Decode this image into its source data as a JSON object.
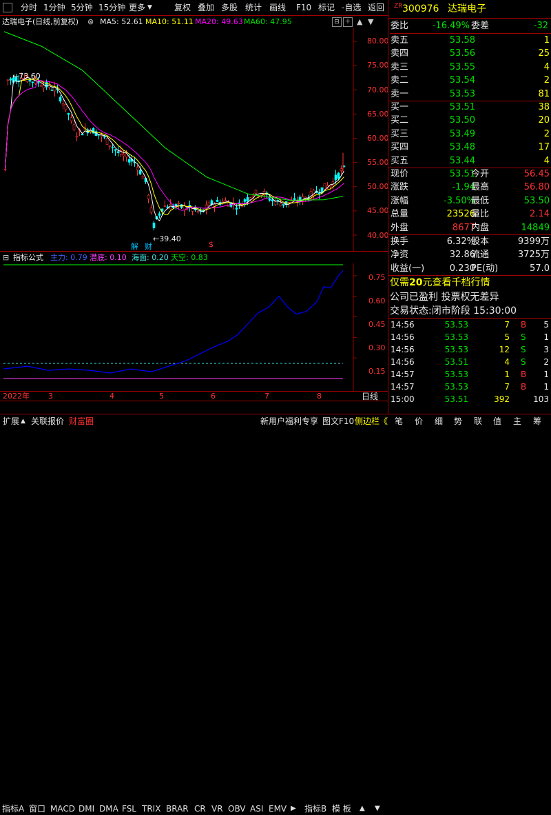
{
  "toolbar": {
    "items": [
      "分时",
      "1分钟",
      "5分钟",
      "15分钟",
      "更多",
      "复权",
      "叠加",
      "多股",
      "统计",
      "画线",
      "F10",
      "标记",
      "-自选",
      "返回"
    ]
  },
  "chart_header": {
    "name": "达瑞电子(日线,前复权)",
    "ma5": "MA5: 52.61",
    "ma10": "MA10: 51.11",
    "ma20": "MA20: 49.63",
    "ma60": "MA60: 47.95"
  },
  "price_axis": [
    "80.00",
    "75.00",
    "70.00",
    "65.00",
    "60.00",
    "55.00",
    "50.00",
    "45.00",
    "40.00"
  ],
  "annotations": {
    "high": "73.60",
    "low": "39.40",
    "jie": "解",
    "cai": "财",
    "s": "$"
  },
  "indicator_header": {
    "title": "指标公式",
    "zl": "主力: 0.79",
    "qd": "潜底: 0.10",
    "hm": "海面: 0.20",
    "tk": "天空: 0.83"
  },
  "indicator_axis": [
    "0.75",
    "0.60",
    "0.45",
    "0.30",
    "0.15"
  ],
  "date_axis": {
    "year": "2022年",
    "months": [
      "3",
      "4",
      "5",
      "6",
      "7",
      "8"
    ],
    "period": "日线"
  },
  "tabs": [
    "指标A",
    "窗口",
    "MACD",
    "DMI",
    "DMA",
    "FSL",
    "TRIX",
    "BRAR",
    "CR",
    "VR",
    "OBV",
    "ASI",
    "EMV",
    "指标B",
    "模 板"
  ],
  "bottom_tabs": [
    "扩展",
    "关联报价",
    "财富圈"
  ],
  "bottom_right": [
    "新用户福利专享",
    "图文F10",
    "侧边栏《"
  ],
  "side_tabs": [
    "笔",
    "价",
    "细",
    "势",
    "联",
    "值",
    "主",
    "筹"
  ],
  "stock": {
    "badge": "ZR",
    "code": "300976",
    "name": "达瑞电子"
  },
  "order_ratio": {
    "wb_label": "委比",
    "wb": "-16.49%",
    "wc_label": "委差",
    "wc": "-32"
  },
  "asks": [
    {
      "label": "卖五",
      "price": "53.58",
      "vol": "1"
    },
    {
      "label": "卖四",
      "price": "53.56",
      "vol": "25"
    },
    {
      "label": "卖三",
      "price": "53.55",
      "vol": "4"
    },
    {
      "label": "卖二",
      "price": "53.54",
      "vol": "2"
    },
    {
      "label": "卖一",
      "price": "53.53",
      "vol": "81"
    }
  ],
  "bids": [
    {
      "label": "买一",
      "price": "53.51",
      "vol": "38"
    },
    {
      "label": "买二",
      "price": "53.50",
      "vol": "20"
    },
    {
      "label": "买三",
      "price": "53.49",
      "vol": "2"
    },
    {
      "label": "买四",
      "price": "53.48",
      "vol": "17"
    },
    {
      "label": "买五",
      "price": "53.44",
      "vol": "4"
    }
  ],
  "stats": [
    {
      "l1": "现价",
      "v1": "53.51",
      "l2": "今开",
      "v2": "56.45"
    },
    {
      "l1": "涨跌",
      "v1": "-1.94",
      "l2": "最高",
      "v2": "56.80"
    },
    {
      "l1": "涨幅",
      "v1": "-3.50%",
      "l2": "最低",
      "v2": "53.50"
    },
    {
      "l1": "总量",
      "v1": "23526",
      "l2": "量比",
      "v2": "2.14"
    },
    {
      "l1": "外盘",
      "v1": "8677",
      "l2": "内盘",
      "v2": "14849"
    }
  ],
  "stats2": [
    {
      "l1": "换手",
      "v1": "6.32%",
      "l2": "股本",
      "v2": "9399万"
    },
    {
      "l1": "净资",
      "v1": "32.86",
      "l2": "流通",
      "v2": "3725万"
    },
    {
      "l1": "收益(一)",
      "v1": "0.230",
      "l2": "PE(动)",
      "v2": "57.0"
    }
  ],
  "promo": {
    "pre": "仅需",
    "price": "20",
    "post": "元查看千档行情"
  },
  "company_note": "公司已盈利 投票权无差异",
  "trade_status": {
    "label": "交易状态:",
    "value": "闭市阶段 15:30:00"
  },
  "ticks": [
    {
      "t": "14:56",
      "p": "53.53",
      "v": "7",
      "bs": "B",
      "n": "5"
    },
    {
      "t": "14:56",
      "p": "53.53",
      "v": "5",
      "bs": "S",
      "n": "1"
    },
    {
      "t": "14:56",
      "p": "53.53",
      "v": "12",
      "bs": "S",
      "n": "3"
    },
    {
      "t": "14:56",
      "p": "53.51",
      "v": "4",
      "bs": "S",
      "n": "2"
    },
    {
      "t": "14:57",
      "p": "53.53",
      "v": "1",
      "bs": "B",
      "n": "1"
    },
    {
      "t": "14:57",
      "p": "53.53",
      "v": "7",
      "bs": "B",
      "n": "1"
    },
    {
      "t": "15:00",
      "p": "53.51",
      "v": "392",
      "bs": "",
      "n": "103"
    }
  ],
  "colors": {
    "ma5": "#ffffff",
    "ma10": "#ffff00",
    "ma20": "#ff00ff",
    "ma60": "#00ff00",
    "up": "#ff3232",
    "down": "#00ffff",
    "border": "#a00000",
    "indicator": "#0000ff"
  }
}
